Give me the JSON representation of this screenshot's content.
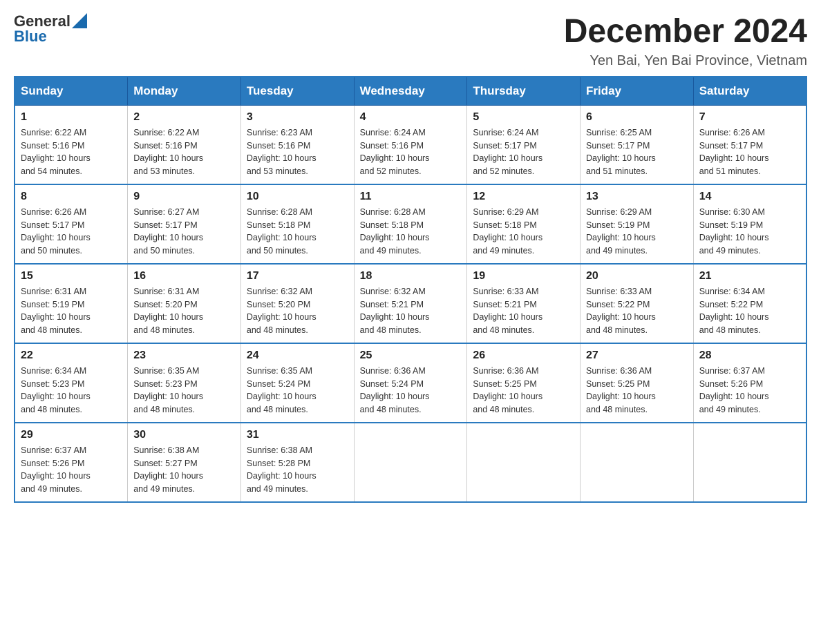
{
  "logo": {
    "text_general": "General",
    "text_blue": "Blue"
  },
  "header": {
    "title": "December 2024",
    "subtitle": "Yen Bai, Yen Bai Province, Vietnam"
  },
  "days_of_week": [
    "Sunday",
    "Monday",
    "Tuesday",
    "Wednesday",
    "Thursday",
    "Friday",
    "Saturday"
  ],
  "weeks": [
    [
      {
        "day": "1",
        "sunrise": "6:22 AM",
        "sunset": "5:16 PM",
        "daylight": "10 hours and 54 minutes."
      },
      {
        "day": "2",
        "sunrise": "6:22 AM",
        "sunset": "5:16 PM",
        "daylight": "10 hours and 53 minutes."
      },
      {
        "day": "3",
        "sunrise": "6:23 AM",
        "sunset": "5:16 PM",
        "daylight": "10 hours and 53 minutes."
      },
      {
        "day": "4",
        "sunrise": "6:24 AM",
        "sunset": "5:16 PM",
        "daylight": "10 hours and 52 minutes."
      },
      {
        "day": "5",
        "sunrise": "6:24 AM",
        "sunset": "5:17 PM",
        "daylight": "10 hours and 52 minutes."
      },
      {
        "day": "6",
        "sunrise": "6:25 AM",
        "sunset": "5:17 PM",
        "daylight": "10 hours and 51 minutes."
      },
      {
        "day": "7",
        "sunrise": "6:26 AM",
        "sunset": "5:17 PM",
        "daylight": "10 hours and 51 minutes."
      }
    ],
    [
      {
        "day": "8",
        "sunrise": "6:26 AM",
        "sunset": "5:17 PM",
        "daylight": "10 hours and 50 minutes."
      },
      {
        "day": "9",
        "sunrise": "6:27 AM",
        "sunset": "5:17 PM",
        "daylight": "10 hours and 50 minutes."
      },
      {
        "day": "10",
        "sunrise": "6:28 AM",
        "sunset": "5:18 PM",
        "daylight": "10 hours and 50 minutes."
      },
      {
        "day": "11",
        "sunrise": "6:28 AM",
        "sunset": "5:18 PM",
        "daylight": "10 hours and 49 minutes."
      },
      {
        "day": "12",
        "sunrise": "6:29 AM",
        "sunset": "5:18 PM",
        "daylight": "10 hours and 49 minutes."
      },
      {
        "day": "13",
        "sunrise": "6:29 AM",
        "sunset": "5:19 PM",
        "daylight": "10 hours and 49 minutes."
      },
      {
        "day": "14",
        "sunrise": "6:30 AM",
        "sunset": "5:19 PM",
        "daylight": "10 hours and 49 minutes."
      }
    ],
    [
      {
        "day": "15",
        "sunrise": "6:31 AM",
        "sunset": "5:19 PM",
        "daylight": "10 hours and 48 minutes."
      },
      {
        "day": "16",
        "sunrise": "6:31 AM",
        "sunset": "5:20 PM",
        "daylight": "10 hours and 48 minutes."
      },
      {
        "day": "17",
        "sunrise": "6:32 AM",
        "sunset": "5:20 PM",
        "daylight": "10 hours and 48 minutes."
      },
      {
        "day": "18",
        "sunrise": "6:32 AM",
        "sunset": "5:21 PM",
        "daylight": "10 hours and 48 minutes."
      },
      {
        "day": "19",
        "sunrise": "6:33 AM",
        "sunset": "5:21 PM",
        "daylight": "10 hours and 48 minutes."
      },
      {
        "day": "20",
        "sunrise": "6:33 AM",
        "sunset": "5:22 PM",
        "daylight": "10 hours and 48 minutes."
      },
      {
        "day": "21",
        "sunrise": "6:34 AM",
        "sunset": "5:22 PM",
        "daylight": "10 hours and 48 minutes."
      }
    ],
    [
      {
        "day": "22",
        "sunrise": "6:34 AM",
        "sunset": "5:23 PM",
        "daylight": "10 hours and 48 minutes."
      },
      {
        "day": "23",
        "sunrise": "6:35 AM",
        "sunset": "5:23 PM",
        "daylight": "10 hours and 48 minutes."
      },
      {
        "day": "24",
        "sunrise": "6:35 AM",
        "sunset": "5:24 PM",
        "daylight": "10 hours and 48 minutes."
      },
      {
        "day": "25",
        "sunrise": "6:36 AM",
        "sunset": "5:24 PM",
        "daylight": "10 hours and 48 minutes."
      },
      {
        "day": "26",
        "sunrise": "6:36 AM",
        "sunset": "5:25 PM",
        "daylight": "10 hours and 48 minutes."
      },
      {
        "day": "27",
        "sunrise": "6:36 AM",
        "sunset": "5:25 PM",
        "daylight": "10 hours and 48 minutes."
      },
      {
        "day": "28",
        "sunrise": "6:37 AM",
        "sunset": "5:26 PM",
        "daylight": "10 hours and 49 minutes."
      }
    ],
    [
      {
        "day": "29",
        "sunrise": "6:37 AM",
        "sunset": "5:26 PM",
        "daylight": "10 hours and 49 minutes."
      },
      {
        "day": "30",
        "sunrise": "6:38 AM",
        "sunset": "5:27 PM",
        "daylight": "10 hours and 49 minutes."
      },
      {
        "day": "31",
        "sunrise": "6:38 AM",
        "sunset": "5:28 PM",
        "daylight": "10 hours and 49 minutes."
      },
      null,
      null,
      null,
      null
    ]
  ],
  "labels": {
    "sunrise": "Sunrise:",
    "sunset": "Sunset:",
    "daylight": "Daylight:"
  }
}
